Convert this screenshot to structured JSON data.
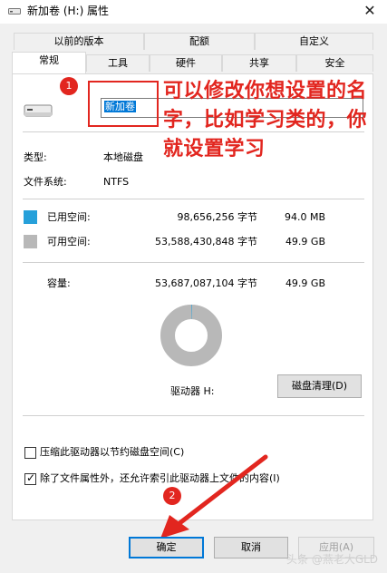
{
  "window": {
    "title": "新加卷 (H:) 属性",
    "close_glyph": "✕"
  },
  "tabs_row1": [
    "以前的版本",
    "配额",
    "自定义"
  ],
  "tabs_row2": [
    "常规",
    "工具",
    "硬件",
    "共享",
    "安全"
  ],
  "general": {
    "volume_name": "新加卷",
    "type_label": "类型:",
    "type_value": "本地磁盘",
    "fs_label": "文件系统:",
    "fs_value": "NTFS",
    "used": {
      "label": "已用空间:",
      "bytes": "98,656,256 字节",
      "size": "94.0 MB",
      "color": "#26a0da"
    },
    "free": {
      "label": "可用空间:",
      "bytes": "53,588,430,848 字节",
      "size": "49.9 GB",
      "color": "#b8b8b8"
    },
    "capacity": {
      "label": "容量:",
      "bytes": "53,687,087,104 字节",
      "size": "49.9 GB"
    },
    "used_fraction": 0.0018,
    "drive_label": "驱动器 H:",
    "cleanup_button": "磁盘清理(D)",
    "compress_label": "压缩此驱动器以节约磁盘空间(C)",
    "compress_checked": false,
    "index_label": "除了文件属性外，还允许索引此驱动器上文件的内容(I)",
    "index_checked": true
  },
  "annotation": {
    "badge1": "1",
    "badge2": "2",
    "text_line1": "可以修改你想设置的名",
    "text_line2": "字，比如学习类的，你",
    "text_line3": "就设置学习",
    "color": "#e2261f"
  },
  "buttons": {
    "ok": "确定",
    "cancel": "取消",
    "apply": "应用(A)"
  },
  "watermark": "头条 @燕老大GLD"
}
